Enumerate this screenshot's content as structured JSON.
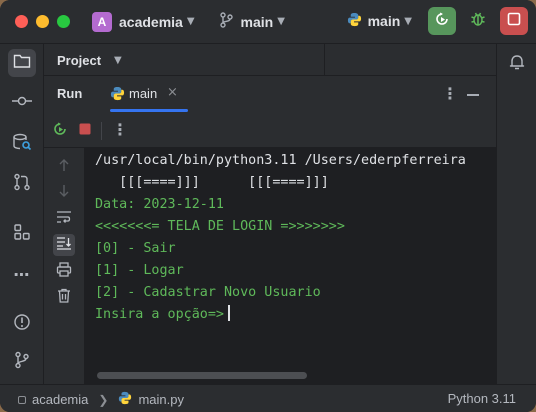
{
  "titlebar": {
    "project_badge": "A",
    "project_name": "academia",
    "branch": "main",
    "run_config": "main"
  },
  "project_panel": {
    "title": "Project"
  },
  "run_panel": {
    "label": "Run",
    "tab": {
      "label": "main",
      "close": "×"
    }
  },
  "console": {
    "lines": [
      {
        "text": "/usr/local/bin/python3.11 /Users/ederpferreira",
        "style": "plain"
      },
      {
        "text": "   [[[====]]]      [[[====]]]",
        "style": "plain"
      },
      {
        "text": "Data: 2023-12-11",
        "style": "green"
      },
      {
        "text": "<<<<<<<= TELA DE LOGIN =>>>>>>>",
        "style": "green"
      },
      {
        "text": "[0] - Sair",
        "style": "green"
      },
      {
        "text": "[1] - Logar",
        "style": "green"
      },
      {
        "text": "[2] - Cadastrar Novo Usuario",
        "style": "green"
      },
      {
        "text": "Insira a opção=>",
        "style": "green"
      }
    ]
  },
  "statusbar": {
    "project": "academia",
    "file": "main.py",
    "interpreter": "Python 3.11"
  },
  "colors": {
    "accent": "#3574f0",
    "output_green": "#5fb95a",
    "rerun_button": "#57965c",
    "stop_button": "#c94f4f",
    "project_badge": "#b46bd0"
  }
}
